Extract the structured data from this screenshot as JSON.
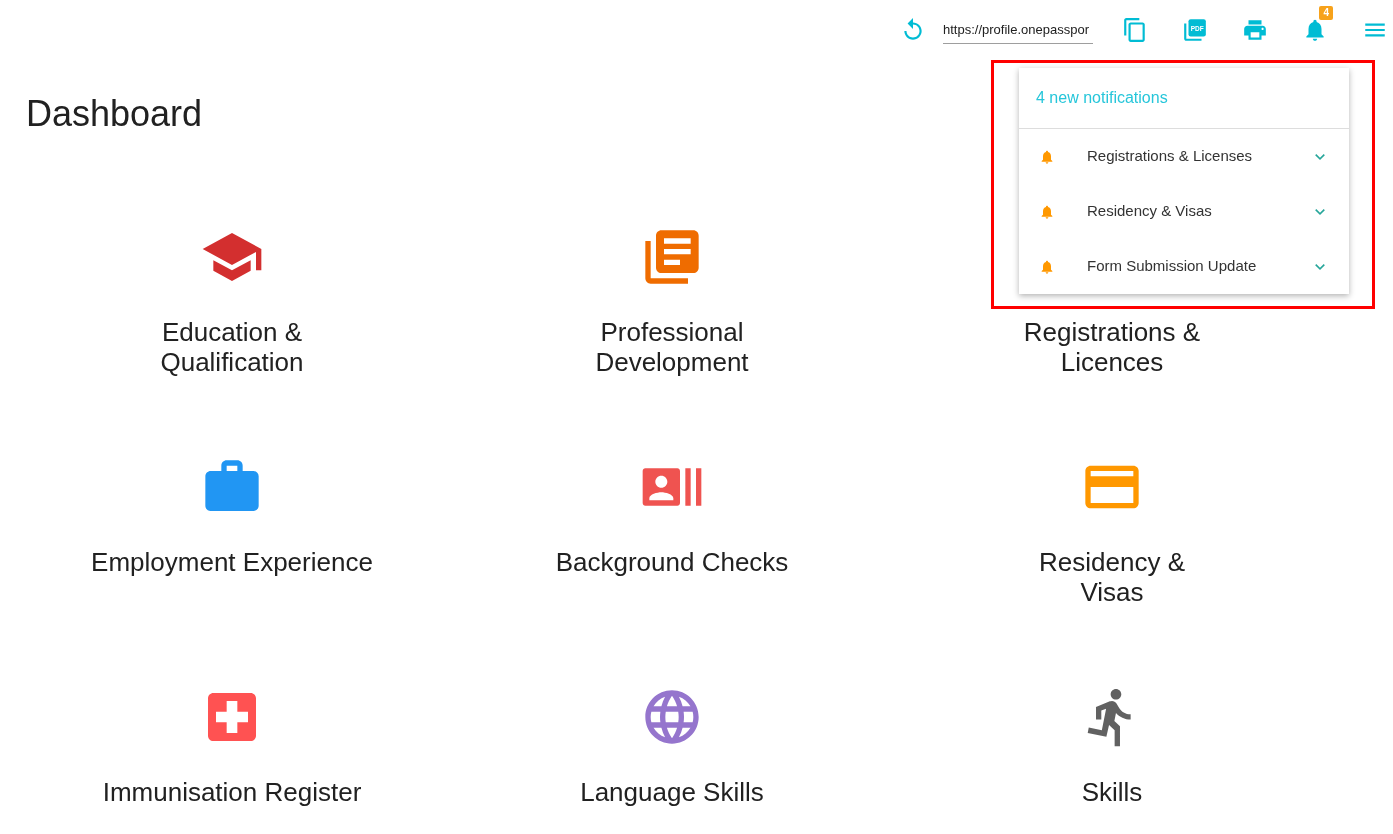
{
  "toolbar": {
    "url_field": {
      "value": "https://profile.onepasspor"
    },
    "pdf_label": "PDF",
    "notification_badge": "4"
  },
  "page_title": "Dashboard",
  "tiles": [
    {
      "label_lines": [
        "Education &",
        "Qualification"
      ],
      "kind": "school",
      "color": "#d32f2f"
    },
    {
      "label_lines": [
        "Professional",
        "Development"
      ],
      "kind": "books",
      "color": "#ef6c00"
    },
    {
      "label_lines": [
        "Registrations &",
        "Licences"
      ]
    },
    {
      "label_lines": [
        "Employment Experience"
      ],
      "kind": "briefcase",
      "color": "#2196f3"
    },
    {
      "label_lines": [
        "Background Checks"
      ],
      "kind": "contacts",
      "color": "#ef5350"
    },
    {
      "label_lines": [
        "Residency &",
        "Visas"
      ],
      "kind": "card",
      "color": "#ff9800"
    },
    {
      "label_lines": [
        "Immunisation Register"
      ],
      "kind": "hospital",
      "color": "#ff5252"
    },
    {
      "label_lines": [
        "Language Skills"
      ],
      "kind": "globe",
      "color": "#9575cd"
    },
    {
      "label_lines": [
        "Skills"
      ],
      "kind": "runner",
      "color": "#616161"
    }
  ],
  "notifications": {
    "header": "4 new notifications",
    "items": [
      {
        "title": "Registrations & Licenses"
      },
      {
        "title": "Residency & Visas"
      },
      {
        "title": "Form Submission Update"
      }
    ]
  }
}
